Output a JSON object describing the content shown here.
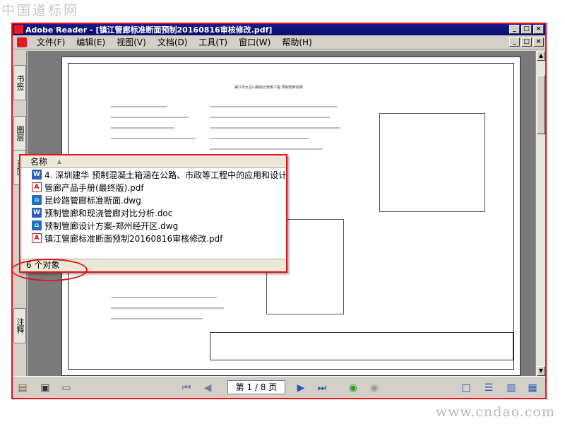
{
  "watermark_top": "中国道标网",
  "watermark_bottom": "www.cndao.com",
  "window": {
    "title": "Adobe Reader - [镇江管廊标准断面预制20160816审核修改.pdf]",
    "controls": [
      "_",
      "□",
      "×"
    ],
    "doc_controls": [
      "_",
      "□",
      "×"
    ]
  },
  "menu": [
    "文件(F)",
    "编辑(E)",
    "视图(V)",
    "文档(D)",
    "工具(T)",
    "窗口(W)",
    "帮助(H)"
  ],
  "left_tabs": [
    "书签",
    "图层",
    "页面",
    "注释"
  ],
  "document": {
    "heading": "镇江市太古山路综合管廊工程  预制管廊说明"
  },
  "navigation": {
    "page_display": "第 1 / 8 页"
  },
  "popup": {
    "column_header": "名称",
    "items": [
      {
        "icon": "word-doc-icon",
        "name": "4. 深圳建华 预制混凝土箱涵在公路、市政等工程中的应用和设计"
      },
      {
        "icon": "pdf-icon",
        "name": "管廊产品手册(最终版).pdf"
      },
      {
        "icon": "dwg-icon",
        "name": "昆岭路管廊标准断面.dwg"
      },
      {
        "icon": "word-doc-icon",
        "name": "预制管廊和现浇管廊对比分析.doc"
      },
      {
        "icon": "dwg-icon",
        "name": "预制管廊设计方案-郑州经开区.dwg"
      },
      {
        "icon": "pdf-icon",
        "name": "镇江管廊标准断面预制20160816审核修改.pdf"
      }
    ],
    "status": "6 个对象"
  },
  "colors": {
    "highlight_red": "#e0141a",
    "titlebar_blue": "#0b0b6a",
    "viewport_gray": "#7a7a7a"
  }
}
